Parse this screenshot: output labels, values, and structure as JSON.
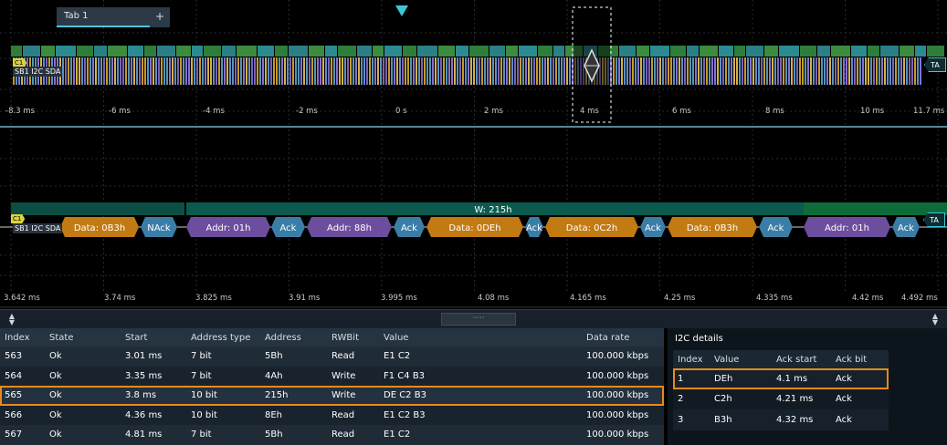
{
  "tabs": [
    {
      "label": "Tab 1"
    }
  ],
  "tab_add_label": "+",
  "overview": {
    "channel_marker": "C1",
    "channel_label": "SB1 I2C SDA",
    "trigger_badge": "TA",
    "time_ticks": [
      "-8.3 ms",
      "-6 ms",
      "-4 ms",
      "-2 ms",
      "0 s",
      "2 ms",
      "4 ms",
      "6 ms",
      "8 ms",
      "10 ms",
      "11.7 ms"
    ]
  },
  "zoom": {
    "channel_marker": "C1",
    "channel_label": "SB1 I2C SDA",
    "trigger_badge": "TA",
    "frame_label": "W: 215h",
    "time_ticks": [
      "3.642 ms",
      "3.74 ms",
      "3.825 ms",
      "3.91 ms",
      "3.995 ms",
      "4.08 ms",
      "4.165 ms",
      "4.25 ms",
      "4.335 ms",
      "4.42 ms",
      "4.492 ms"
    ],
    "segments": [
      {
        "label": "Data: 0B3h",
        "kind": "data"
      },
      {
        "label": "NAck",
        "kind": "ack"
      },
      {
        "label": "Addr: 01h",
        "kind": "addr"
      },
      {
        "label": "Ack",
        "kind": "ack"
      },
      {
        "label": "Addr: 88h",
        "kind": "addr"
      },
      {
        "label": "Ack",
        "kind": "ack"
      },
      {
        "label": "Data: 0DEh",
        "kind": "data"
      },
      {
        "label": "Ack",
        "kind": "ack"
      },
      {
        "label": "Data: 0C2h",
        "kind": "data"
      },
      {
        "label": "Ack",
        "kind": "ack"
      },
      {
        "label": "Data: 0B3h",
        "kind": "data"
      },
      {
        "label": "Ack",
        "kind": "ack"
      },
      {
        "label": "Addr: 01h",
        "kind": "addr"
      },
      {
        "label": "Ack",
        "kind": "ack"
      }
    ]
  },
  "colors": {
    "accent": "#3fc6d6",
    "selection": "#e88a1a",
    "data_segment": "#c27a12",
    "addr_segment": "#6c4d9e",
    "ack_segment": "#3a7ea8",
    "frame_band": "#0c5a4e"
  },
  "splitter": {
    "grip": "·····",
    "sort_icon": "sort-arrows-icon"
  },
  "results": {
    "columns": [
      "Index",
      "State",
      "Start",
      "Address type",
      "Address",
      "RWBit",
      "Value",
      "Data rate"
    ],
    "rows": [
      [
        "563",
        "Ok",
        "3.01 ms",
        "7 bit",
        "5Bh",
        "Read",
        "E1 C2",
        "100.000 kbps"
      ],
      [
        "564",
        "Ok",
        "3.35 ms",
        "7 bit",
        "4Ah",
        "Write",
        "F1 C4 B3",
        "100.000 kbps"
      ],
      [
        "565",
        "Ok",
        "3.8 ms",
        "10 bit",
        "215h",
        "Write",
        "DE C2 B3",
        "100.000 kbps"
      ],
      [
        "566",
        "Ok",
        "4.36 ms",
        "10 bit",
        "8Eh",
        "Read",
        "E1 C2 B3",
        "100.000 kbps"
      ],
      [
        "567",
        "Ok",
        "4.81 ms",
        "7 bit",
        "5Bh",
        "Read",
        "E1 C2",
        "100.000 kbps"
      ]
    ],
    "selected_row": 2
  },
  "details": {
    "title": "I2C details",
    "columns": [
      "Index",
      "Value",
      "Ack start",
      "Ack bit"
    ],
    "rows": [
      [
        "1",
        "DEh",
        "4.1 ms",
        "Ack"
      ],
      [
        "2",
        "C2h",
        "4.21 ms",
        "Ack"
      ],
      [
        "3",
        "B3h",
        "4.32 ms",
        "Ack"
      ]
    ],
    "selected_row": 0
  }
}
